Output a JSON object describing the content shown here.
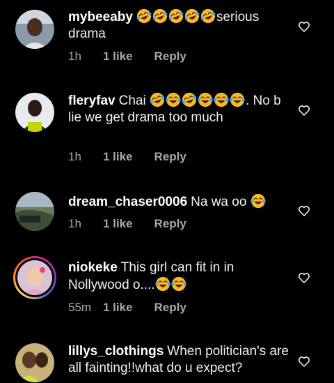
{
  "comments": [
    {
      "username": "mybeeaby",
      "pre_text": "",
      "emojis_inline": [
        "laughing-emoji",
        "laughing-emoji",
        "laughing-emoji",
        "laughing-emoji",
        "laughing-emoji"
      ],
      "post_text": "serious drama",
      "time": "1h",
      "likes": "1 like",
      "reply": "Reply",
      "avatar_icon": "profile-photo"
    },
    {
      "username": "fleryfav",
      "pre_text": "Chai",
      "emojis_inline": [
        "laughing-emoji",
        "tears-of-joy-emoji",
        "laughing-emoji",
        "tears-of-joy-emoji",
        "tears-of-joy-emoji",
        "tears-of-joy-emoji"
      ],
      "post_text": ". No b lie we get drama too much",
      "time": "1h",
      "likes": "1 like",
      "reply": "Reply",
      "avatar_icon": "profile-photo"
    },
    {
      "username": "dream_chaser0006",
      "pre_text": "Na wa oo",
      "emojis_inline": [
        "tears-of-joy-emoji"
      ],
      "post_text": "",
      "time": "1h",
      "likes": "1 like",
      "reply": "Reply",
      "avatar_icon": "profile-photo"
    },
    {
      "username": "niokeke",
      "pre_text": "This girl can fit in in Nollywood o....",
      "emojis_inline": [
        "tears-of-joy-emoji",
        "tears-of-joy-emoji"
      ],
      "post_text": "",
      "time": "55m",
      "likes": "1 like",
      "reply": "Reply",
      "avatar_icon": "profile-photo-with-story-ring"
    },
    {
      "username": "lillys_clothings",
      "pre_text": "When politician's are all fainting!!what do u expect?",
      "emojis_inline": [],
      "post_text": "",
      "time": "",
      "likes": "",
      "reply": "",
      "avatar_icon": "profile-photo"
    }
  ],
  "colors": {
    "background": "#000000",
    "text": "#f2f2f2",
    "meta": "#a8a8a8",
    "emoji_face": "#f7b928"
  },
  "icons": {
    "like": "heart-outline-icon"
  }
}
